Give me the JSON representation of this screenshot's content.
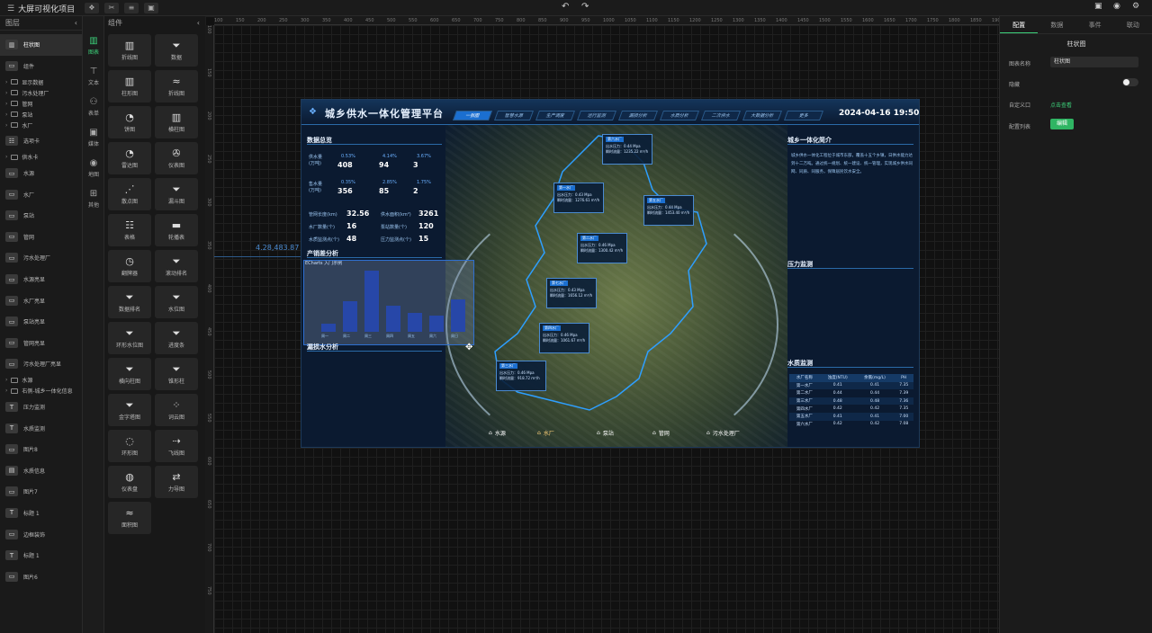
{
  "app": {
    "title": "大屏可视化项目"
  },
  "toolbar": {
    "icons": [
      "layers-icon",
      "cut-icon",
      "sliders-icon",
      "save-icon",
      "undo-icon",
      "redo-icon",
      "save-top-icon",
      "preview-icon",
      "settings-icon"
    ]
  },
  "layers": {
    "header": "图层",
    "items": [
      {
        "kind": "row",
        "icon": "▥",
        "label": "柱状图",
        "selected": true
      },
      {
        "kind": "row",
        "icon": "▭",
        "label": "组件",
        "selected": false
      },
      {
        "kind": "folder",
        "label": "显示数据"
      },
      {
        "kind": "folder",
        "label": "污水处理厂"
      },
      {
        "kind": "folder",
        "label": "管网"
      },
      {
        "kind": "folder",
        "label": "泵站"
      },
      {
        "kind": "folder",
        "label": "水厂"
      },
      {
        "kind": "row",
        "icon": "☷",
        "label": "选项卡",
        "selected": false
      },
      {
        "kind": "folder",
        "label": "供水卡"
      },
      {
        "kind": "row",
        "icon": "▭",
        "label": "水源",
        "selected": false
      },
      {
        "kind": "row",
        "icon": "▭",
        "label": "水厂",
        "selected": false
      },
      {
        "kind": "row",
        "icon": "▭",
        "label": "泵站",
        "selected": false
      },
      {
        "kind": "row",
        "icon": "▭",
        "label": "管网",
        "selected": false
      },
      {
        "kind": "row",
        "icon": "▭",
        "label": "污水处理厂",
        "selected": false
      },
      {
        "kind": "row",
        "icon": "▭",
        "label": "水源亮显",
        "selected": false
      },
      {
        "kind": "row",
        "icon": "▭",
        "label": "水厂亮显",
        "selected": false
      },
      {
        "kind": "row",
        "icon": "▭",
        "label": "泵站亮显",
        "selected": false
      },
      {
        "kind": "row",
        "icon": "▭",
        "label": "管网亮显",
        "selected": false
      },
      {
        "kind": "row",
        "icon": "▭",
        "label": "污水处理厂亮显",
        "selected": false
      },
      {
        "kind": "folder",
        "label": "水源"
      },
      {
        "kind": "folder",
        "label": "右侧-城乡一体化信息"
      },
      {
        "kind": "row",
        "icon": "T",
        "label": "压力监测",
        "selected": false
      },
      {
        "kind": "row",
        "icon": "T",
        "label": "水质监测",
        "selected": false
      },
      {
        "kind": "row",
        "icon": "▭",
        "label": "图片8",
        "selected": false
      },
      {
        "kind": "row",
        "icon": "▤",
        "label": "水质信息",
        "selected": false
      },
      {
        "kind": "row",
        "icon": "▭",
        "label": "图片7",
        "selected": false
      },
      {
        "kind": "row",
        "icon": "T",
        "label": "标题 1",
        "selected": false
      },
      {
        "kind": "row",
        "icon": "▭",
        "label": "边框装饰",
        "selected": false
      },
      {
        "kind": "row",
        "icon": "T",
        "label": "标题 1",
        "selected": false
      },
      {
        "kind": "row",
        "icon": "▭",
        "label": "图片6",
        "selected": false
      }
    ]
  },
  "categories": {
    "header": "组件",
    "items": [
      {
        "icon": "▥",
        "label": "图表",
        "active": true
      },
      {
        "icon": "⊤",
        "label": "文本"
      },
      {
        "icon": "⚇",
        "label": "表单"
      },
      {
        "icon": "▣",
        "label": "媒体"
      },
      {
        "icon": "◉",
        "label": "地图"
      },
      {
        "icon": "⊞",
        "label": "其他"
      }
    ]
  },
  "components": [
    {
      "icon": "▥",
      "label": "折线图"
    },
    {
      "icon": "⏷",
      "label": "数据"
    },
    {
      "icon": "▥",
      "label": "柱形图"
    },
    {
      "icon": "≈",
      "label": "折线图"
    },
    {
      "icon": "◔",
      "label": "饼图"
    },
    {
      "icon": "▥",
      "label": "横柱图"
    },
    {
      "icon": "◔",
      "label": "雷达图"
    },
    {
      "icon": "✇",
      "label": "仪表图"
    },
    {
      "icon": "⋰",
      "label": "散点图"
    },
    {
      "icon": "⏷",
      "label": "漏斗图"
    },
    {
      "icon": "☷",
      "label": "表格"
    },
    {
      "icon": "▬",
      "label": "轮播表"
    },
    {
      "icon": "◷",
      "label": "翻牌器"
    },
    {
      "icon": "⏷",
      "label": "滚动排名"
    },
    {
      "icon": "⏷",
      "label": "数据排名"
    },
    {
      "icon": "⏷",
      "label": "水位图"
    },
    {
      "icon": "⏷",
      "label": "环形水位图"
    },
    {
      "icon": "⏷",
      "label": "进度条"
    },
    {
      "icon": "⏷",
      "label": "横向柱图"
    },
    {
      "icon": "⏷",
      "label": "锥形柱"
    },
    {
      "icon": "⏷",
      "label": "金字塔图"
    },
    {
      "icon": "⁘",
      "label": "词云图"
    },
    {
      "icon": "◌",
      "label": "环形图"
    },
    {
      "icon": "⇢",
      "label": "飞线图"
    },
    {
      "icon": "◍",
      "label": "仪表盘"
    },
    {
      "icon": "⇄",
      "label": "力导图"
    },
    {
      "icon": "≈",
      "label": "面积图"
    }
  ],
  "canvas": {
    "ruler_h": [
      "100",
      "150",
      "200",
      "250",
      "300",
      "350",
      "400",
      "450",
      "500",
      "550",
      "600",
      "650",
      "700",
      "750",
      "800",
      "850",
      "900",
      "950",
      "1000",
      "1050",
      "1100",
      "1150",
      "1200",
      "1250",
      "1300",
      "1350",
      "1400",
      "1450",
      "1500",
      "1550",
      "1600",
      "1650",
      "1700",
      "1750",
      "1800",
      "1850",
      "1900"
    ],
    "coord_label": "4.28,483.87",
    "chart_tooltip": "ECharts 入门示例"
  },
  "dashboard": {
    "title": "城乡供水一体化管理平台",
    "datetime": "2024-04-16 19:50",
    "tabs": [
      "一张图",
      "智慧水源",
      "生产调度",
      "运行监测",
      "漏损分析",
      "水质分析",
      "二次供水",
      "大数据分析",
      "更多"
    ],
    "left_title_1": "数据总览",
    "supply_label": "供水量\n(万吨)",
    "supply_values": [
      "408",
      "94",
      "3"
    ],
    "sales_label": "售水量\n(万吨)",
    "sales_values": [
      "356",
      "85",
      "2"
    ],
    "ring_labels": [
      "0.53%",
      "4.14%",
      "3.67%",
      "0.35%",
      "2.85%",
      "1.75%"
    ],
    "metrics": [
      {
        "label": "管网长度(km)",
        "value": "32.56"
      },
      {
        "label": "供水面积(km²)",
        "value": "3261"
      },
      {
        "label": "水厂数量(个)",
        "value": "16"
      },
      {
        "label": "泵站数量(个)",
        "value": "120"
      },
      {
        "label": "水质监测点(个)",
        "value": "48"
      },
      {
        "label": "压力监测点(个)",
        "value": "15"
      }
    ],
    "left_title_2": "产销差分析",
    "left_title_3": "漏损水分析",
    "right_title_1": "城乡一体化简介",
    "intro_text": "城乡供水一体化工程位于城市东部，覆盖十五个乡镇，日供水能力达到十二万吨。通过统一规划、统一建设、统一管理，实现城乡供水同网、同质、同服务，保障居民饮水安全。",
    "right_title_2": "压力监测",
    "right_title_3": "水质监测",
    "water_table": {
      "headers": [
        "水厂名称",
        "浊度(NTU)",
        "余氯(mg/L)",
        "PH"
      ],
      "rows": [
        [
          "第一水厂",
          "0.41",
          "0.41",
          "7.35"
        ],
        [
          "第二水厂",
          "0.44",
          "0.44",
          "7.39"
        ],
        [
          "第三水厂",
          "0.48",
          "0.48",
          "7.36"
        ],
        [
          "第四水厂",
          "0.42",
          "0.42",
          "7.35"
        ],
        [
          "第五水厂",
          "0.41",
          "0.41",
          "7.00"
        ],
        [
          "第六水厂",
          "0.42",
          "0.42",
          "7.08"
        ]
      ]
    },
    "popups": [
      {
        "name": "第六水厂",
        "l1": "出水压力：0.44 Mpa",
        "l2": "瞬时流量：1235.22 m³/h"
      },
      {
        "name": "第一水厂",
        "l1": "出水压力：0.43 Mpa",
        "l2": "瞬时流量：1276.61 m³/h"
      },
      {
        "name": "第五水厂",
        "l1": "出水压力：0.44 Mpa",
        "l2": "瞬时流量：1453.40 m³/h"
      },
      {
        "name": "第二水厂",
        "l1": "出水压力：0.46 Mpa",
        "l2": "瞬时流量：1300.42 m³/h"
      },
      {
        "name": "第七水厂",
        "l1": "出水压力：0.43 Mpa",
        "l2": "瞬时流量：1656.12 m³/h"
      },
      {
        "name": "第四水厂",
        "l1": "出水压力：0.46 Mpa",
        "l2": "瞬时流量：1061.67 m³/h"
      },
      {
        "name": "第三水厂",
        "l1": "出水压力：0.46 Mpa",
        "l2": "瞬时流量：918.72 m³/h"
      }
    ],
    "nav": [
      "水源",
      "水厂",
      "泵站",
      "管网",
      "污水处理厂"
    ],
    "bar_values": [
      12,
      48,
      95,
      40,
      30,
      25,
      50
    ],
    "bar_axis": [
      "周一",
      "周二",
      "周三",
      "周四",
      "周五",
      "周六",
      "周日"
    ]
  },
  "props": {
    "tabs": [
      "配置",
      "数据",
      "事件",
      "联动"
    ],
    "component_name": "柱状图",
    "rows": [
      {
        "label": "图表名称",
        "value": "柱状图"
      },
      {
        "label": "隐藏",
        "value": ""
      },
      {
        "label": "自定义口",
        "value": "点击查看"
      },
      {
        "label": "配置列表",
        "value": "编辑"
      }
    ]
  }
}
